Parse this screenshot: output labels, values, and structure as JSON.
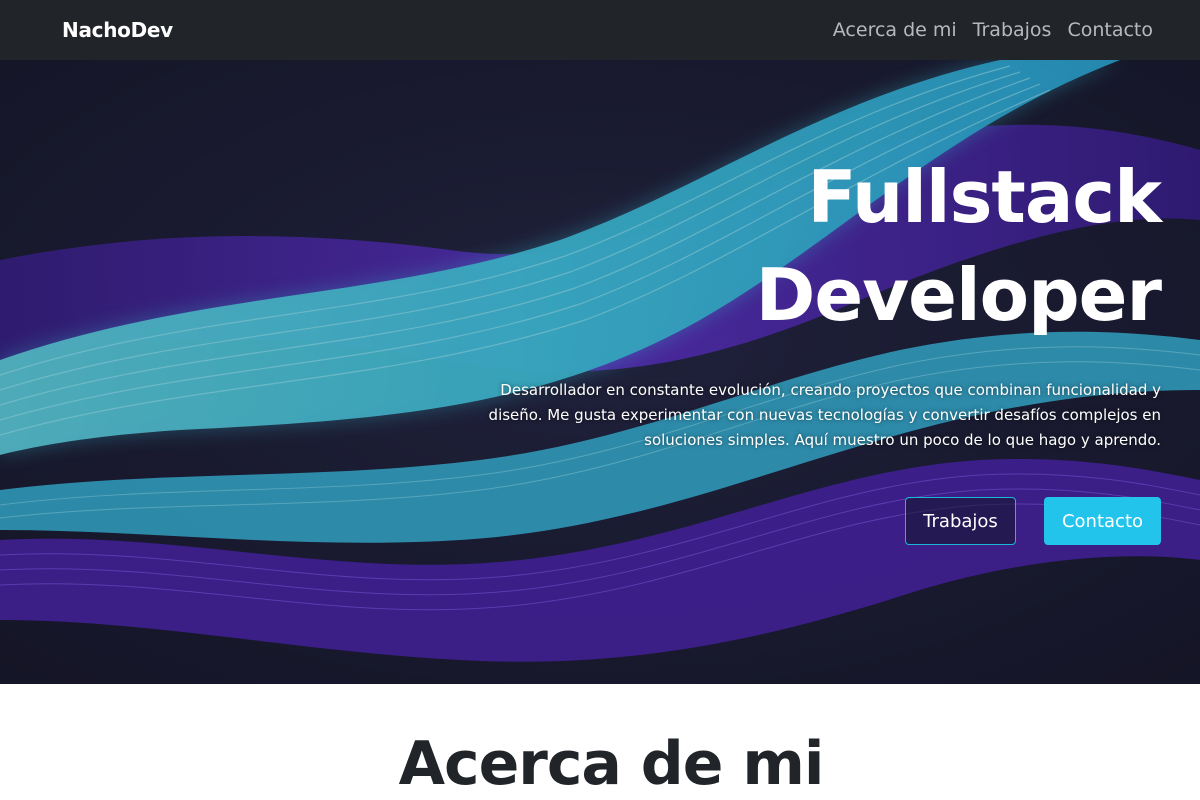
{
  "navbar": {
    "brand": "NachoDev",
    "links": [
      "Acerca de mi",
      "Trabajos",
      "Contacto"
    ]
  },
  "hero": {
    "title_line1": "Fullstack",
    "title_line2": "Developer",
    "description": "Desarrollador en constante evolución, creando proyectos que combinan funcionalidad y diseño. Me gusta experimentar con nuevas tecnologías y convertir desafíos complejos en soluciones simples. Aquí muestro un poco de lo que hago y aprendo.",
    "buttons": {
      "primary_outline": "Trabajos",
      "secondary_solid": "Contacto"
    }
  },
  "about": {
    "title": "Acerca de mi"
  },
  "colors": {
    "navbar_bg": "#212529",
    "hero_bg": "#1a1b2c",
    "accent_cyan": "#22c4ec",
    "accent_purple": "#5b2bc4",
    "text_dark": "#212529"
  }
}
